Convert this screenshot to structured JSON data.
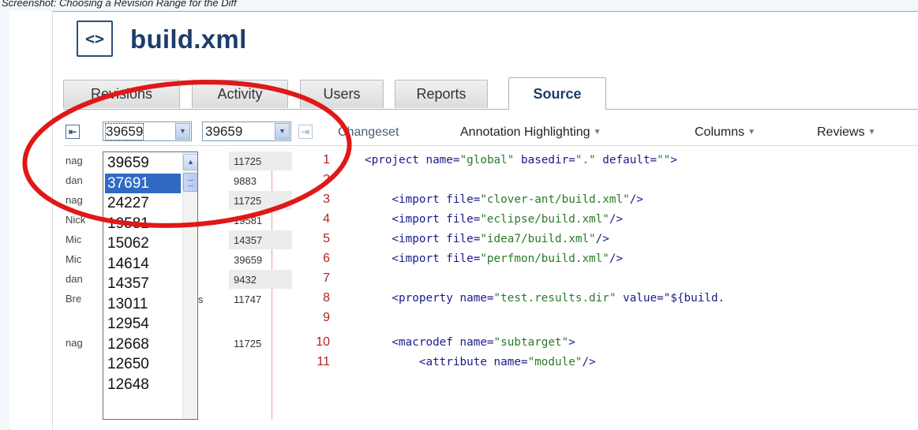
{
  "caption": "Screenshot: Choosing a Revision Range for the Diff",
  "file": {
    "title": "build.xml",
    "icon": "code-file-icon"
  },
  "tabs": [
    {
      "label": "Revisions",
      "active": false
    },
    {
      "label": "Activity",
      "active": false
    },
    {
      "label": "Users",
      "active": false
    },
    {
      "label": "Reports",
      "active": false
    },
    {
      "label": "Source",
      "active": true
    }
  ],
  "toolbar": {
    "from_revision": "39659",
    "to_revision": "39659",
    "changeset_label": "Changeset",
    "annotation_label": "Annotation Highlighting",
    "columns_label": "Columns",
    "reviews_label": "Reviews"
  },
  "dropdown": {
    "options": [
      "39659",
      "37691",
      "24227",
      "19581",
      "15062",
      "14614",
      "14357",
      "13011",
      "12954",
      "12668",
      "12650",
      "12648"
    ],
    "selected_index": 1
  },
  "rows": [
    {
      "author": "nag",
      "author_tail": "",
      "revision": "11725",
      "line": "1",
      "code": "<project name=\"global\" basedir=\".\" default=\"\">"
    },
    {
      "author": "dan",
      "author_tail": "",
      "revision": "9883",
      "line": "2",
      "code": ""
    },
    {
      "author": "nag",
      "author_tail": "",
      "revision": "11725",
      "line": "3",
      "code": "    <import file=\"clover-ant/build.xml\"/>"
    },
    {
      "author": "Nick",
      "author_tail": "",
      "revision": "19581",
      "line": "4",
      "code": "    <import file=\"eclipse/build.xml\"/>"
    },
    {
      "author": "Mic",
      "author_tail": "",
      "revision": "14357",
      "line": "5",
      "code": "    <import file=\"idea7/build.xml\"/>"
    },
    {
      "author": "Mic",
      "author_tail": "",
      "revision": "39659",
      "line": "6",
      "code": "    <import file=\"perfmon/build.xml\"/>"
    },
    {
      "author": "dan",
      "author_tail": "",
      "revision": "9432",
      "line": "7",
      "code": ""
    },
    {
      "author": "Bre",
      "author_tail": "reys",
      "revision": "11747",
      "line": "8",
      "code": "    <property name=\"test.results.dir\" value=\"${build."
    },
    {
      "author": "",
      "author_tail": "",
      "revision": "",
      "line": "9",
      "code": ""
    },
    {
      "author": "nag",
      "author_tail": "",
      "revision": "11725",
      "line": "10",
      "code": "    <macrodef name=\"subtarget\">"
    },
    {
      "author": "",
      "author_tail": "",
      "revision": "",
      "line": "11",
      "code": "        <attribute name=\"module\"/>"
    }
  ],
  "colors": {
    "annotation_circle": "#e01818",
    "title_blue": "#1d3d6a",
    "line_number_red": "#b22222"
  }
}
